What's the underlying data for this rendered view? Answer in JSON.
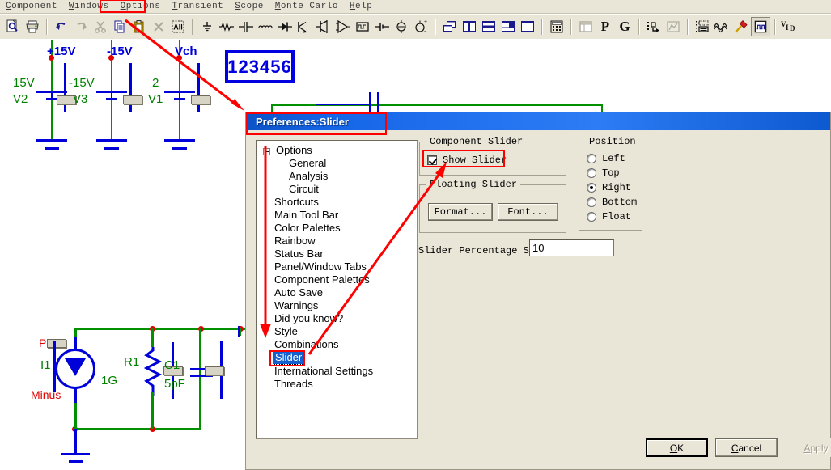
{
  "menu": {
    "items": [
      {
        "label": "Component",
        "accel": "C"
      },
      {
        "label": "Windows",
        "accel": "W"
      },
      {
        "label": "Options",
        "accel": "O"
      },
      {
        "label": "Transient",
        "accel": "T"
      },
      {
        "label": "Scope",
        "accel": "S"
      },
      {
        "label": "Monte Carlo",
        "accel": "M"
      },
      {
        "label": "Help",
        "accel": "H"
      }
    ],
    "highlighted": "Options"
  },
  "toolbar": {
    "groups": [
      [
        "print-preview-icon",
        "print-icon"
      ],
      [
        "undo-icon",
        "redo-icon",
        "cut-icon",
        "copy-icon",
        "paste-icon",
        "delete-icon",
        "select-all-icon"
      ],
      [
        "ground-icon",
        "resistor-icon",
        "capacitor-icon",
        "inductor-icon",
        "diode-icon",
        "scr-icon",
        "npn-transistor-icon",
        "opamp-icon",
        "ic-block-icon",
        "battery-icon",
        "ac-source-icon",
        "dc-source-icon"
      ],
      [
        "tile-windows-icon",
        "tile-vertical-icon",
        "tile-horizontal-icon",
        "cascade-icon",
        "maximize-icon"
      ],
      [
        "calculator-icon"
      ],
      [
        "panel-icon",
        "probe-p-icon",
        "probe-g-icon"
      ],
      [
        "attribute-icon",
        "plot-icon"
      ],
      [
        "grid-text-icon",
        "waveform-icon",
        "probe-tool-icon",
        "scope-window-icon"
      ],
      [
        "vid-label-icon"
      ]
    ],
    "text_buttons": {
      "p": "P",
      "g": "G",
      "vid": "V"
    },
    "vid_sub": "I",
    "vid_sub2": "D"
  },
  "annotation": {
    "number_box": "123456"
  },
  "schematic": {
    "sources": [
      {
        "node_label": "+15V",
        "value": "15V",
        "name": "V2"
      },
      {
        "node_label": "-15V",
        "value": "-15V",
        "name": "V3"
      },
      {
        "node_label": "Vch",
        "value": "2",
        "name": "V1"
      }
    ],
    "current_source": {
      "plus": "Plus",
      "name": "I1",
      "minus": "Minus"
    },
    "resistor": {
      "name": "R1",
      "value": "1G"
    },
    "capacitor": {
      "name": "C1",
      "value": "5pF"
    }
  },
  "dialog": {
    "title": "Preferences:Slider",
    "tree": {
      "root": "Options",
      "children": [
        "General",
        "Analysis",
        "Circuit"
      ],
      "siblings": [
        "Shortcuts",
        "Main Tool Bar",
        "Color Palettes",
        "Rainbow",
        "Status Bar",
        "Panel/Window Tabs",
        "Component Palettes",
        "Auto Save",
        "Warnings",
        "Did you know?",
        "Style",
        "Combinations",
        "Slider",
        "International Settings",
        "Threads"
      ],
      "selected": "Slider"
    },
    "component_slider": {
      "legend": "Component Slider",
      "show_slider_label": "Show Slider",
      "show_slider_checked": true
    },
    "floating_slider": {
      "legend": "Floating Slider",
      "format_button": "Format...",
      "font_button": "Font..."
    },
    "slider_percentage": {
      "label": "Slider Percentage Step",
      "value": "10"
    },
    "position": {
      "legend": "Position",
      "options": [
        "Left",
        "Top",
        "Right",
        "Bottom",
        "Float"
      ],
      "selected": "Right"
    },
    "buttons": {
      "ok": "OK",
      "cancel": "Cancel",
      "apply": "Apply",
      "apply_disabled": true
    }
  },
  "colors": {
    "dialog_bg": "#EAE6D7",
    "titlebar_blue": "#1565E8",
    "annotation_red": "#FF0000",
    "wire_green": "#009000",
    "wire_blue": "#0000D8",
    "node_red": "#E00000",
    "selection_blue": "#1560D0"
  }
}
